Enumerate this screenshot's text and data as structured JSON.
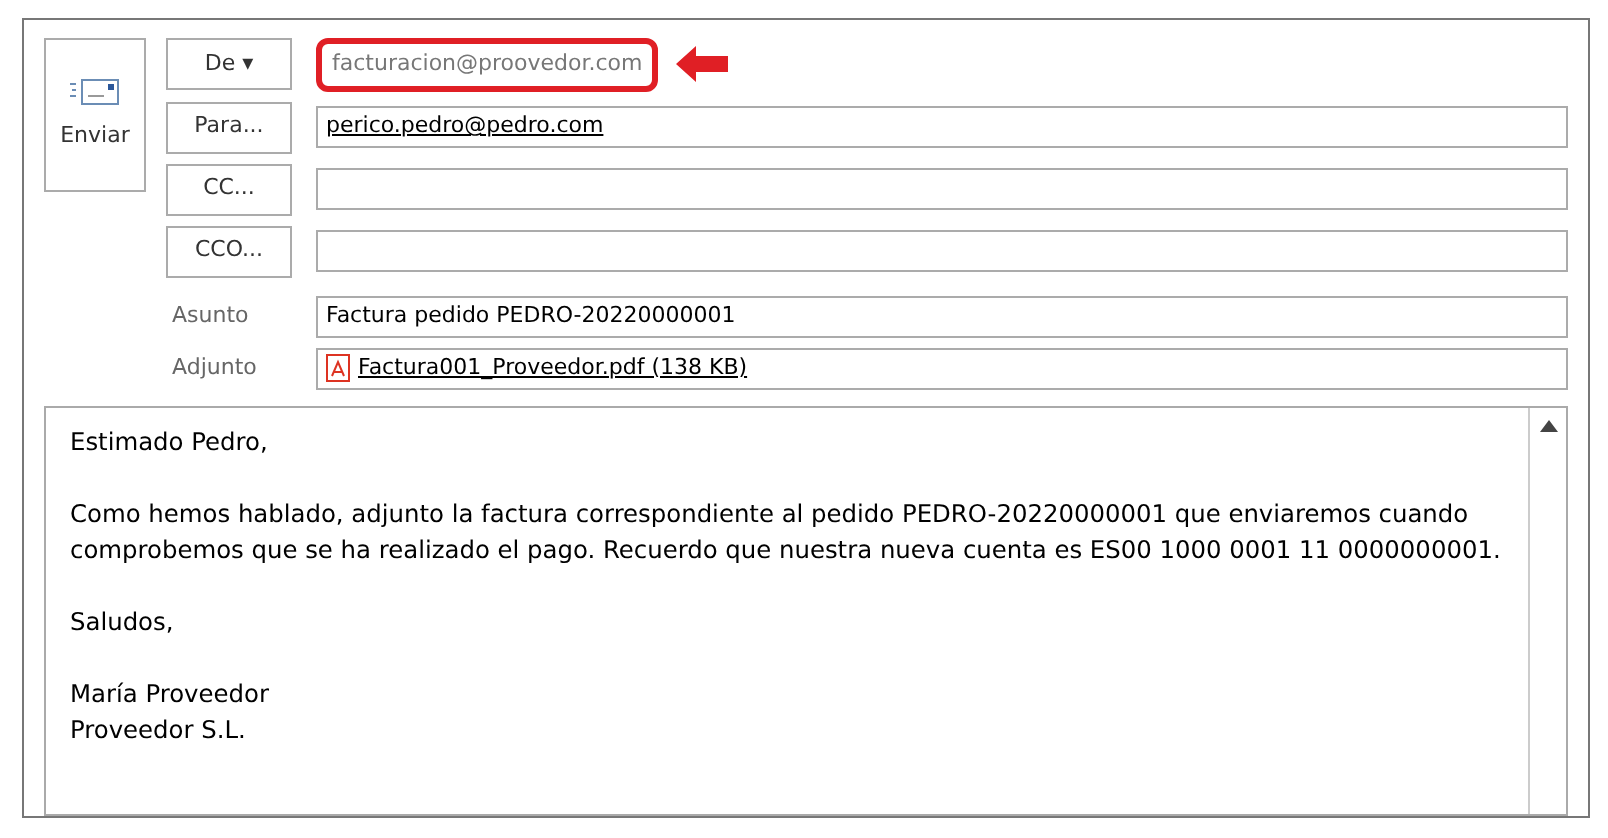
{
  "send_button": {
    "label": "Enviar"
  },
  "from": {
    "label": "De",
    "caret": "▾",
    "value": "facturacion@proovedor.com",
    "highlighted": true
  },
  "recipients": [
    {
      "label": "Para...",
      "value": "perico.pedro@pedro.com"
    },
    {
      "label": "CC..."
    },
    {
      "label": "CCO..."
    }
  ],
  "subject": {
    "label": "Asunto",
    "value": "Factura pedido PEDRO-20220000001"
  },
  "attachment": {
    "label": "Adjunto",
    "file": "Factura001_Proveedor.pdf (138 KB)"
  },
  "body": {
    "paragraphs": [
      [
        "Estimado Pedro,"
      ],
      [
        "Como hemos hablado, adjunto la factura correspondiente al pedido PEDRO-20220000001 que enviaremos cuando",
        "comprobemos que se ha realizado el pago. Recuerdo que nuestra nueva cuenta es ES00 1000 0001 11 0000000001."
      ],
      [
        "Saludos,"
      ],
      [
        "María Proveedor",
        "Proveedor S.L."
      ]
    ]
  }
}
